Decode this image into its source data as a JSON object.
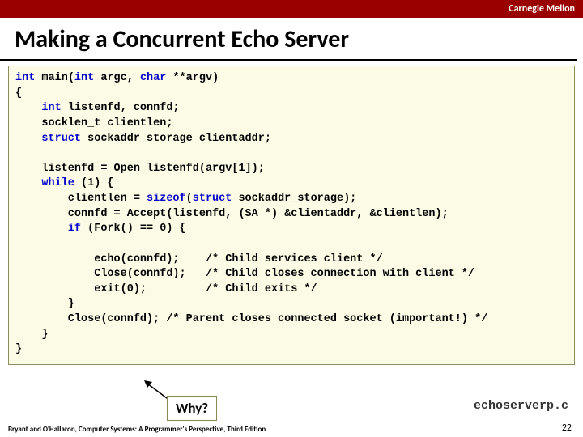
{
  "header": {
    "institution": "Carnegie Mellon"
  },
  "title": "Making a Concurrent Echo Server",
  "code": {
    "l1a": "int",
    "l1b": " main(",
    "l1c": "int",
    "l1d": " argc, ",
    "l1e": "char",
    "l1f": " **argv)",
    "l2": "{",
    "l3a": "    ",
    "l3b": "int",
    "l3c": " listenfd, connfd;",
    "l4": "    socklen_t clientlen;",
    "l5a": "    ",
    "l5b": "struct",
    "l5c": " sockaddr_storage clientaddr;",
    "blank1": "",
    "l6": "    listenfd = Open_listenfd(argv[1]);",
    "l7a": "    ",
    "l7b": "while",
    "l7c": " (1) {",
    "l8a": "        clientlen = ",
    "l8b": "sizeof",
    "l8c": "(",
    "l8d": "struct",
    "l8e": " sockaddr_storage);",
    "l9": "        connfd = Accept(listenfd, (SA *) &clientaddr, &clientlen);",
    "l10a": "        ",
    "l10b": "if",
    "l10c": " (Fork() == 0) {",
    "blank2": "",
    "l11": "            echo(connfd);    /* Child services client */",
    "l12": "            Close(connfd);   /* Child closes connection with client */",
    "l13": "            exit(0);         /* Child exits */",
    "l14": "        }",
    "l15": "        Close(connfd); /* Parent closes connected socket (important!) */",
    "l16": "    }",
    "l17": "}"
  },
  "filename": "echoserverp.c",
  "callout": "Why?",
  "footer": "Bryant and O'Hallaron, Computer Systems: A Programmer's Perspective, Third Edition",
  "page": "22"
}
